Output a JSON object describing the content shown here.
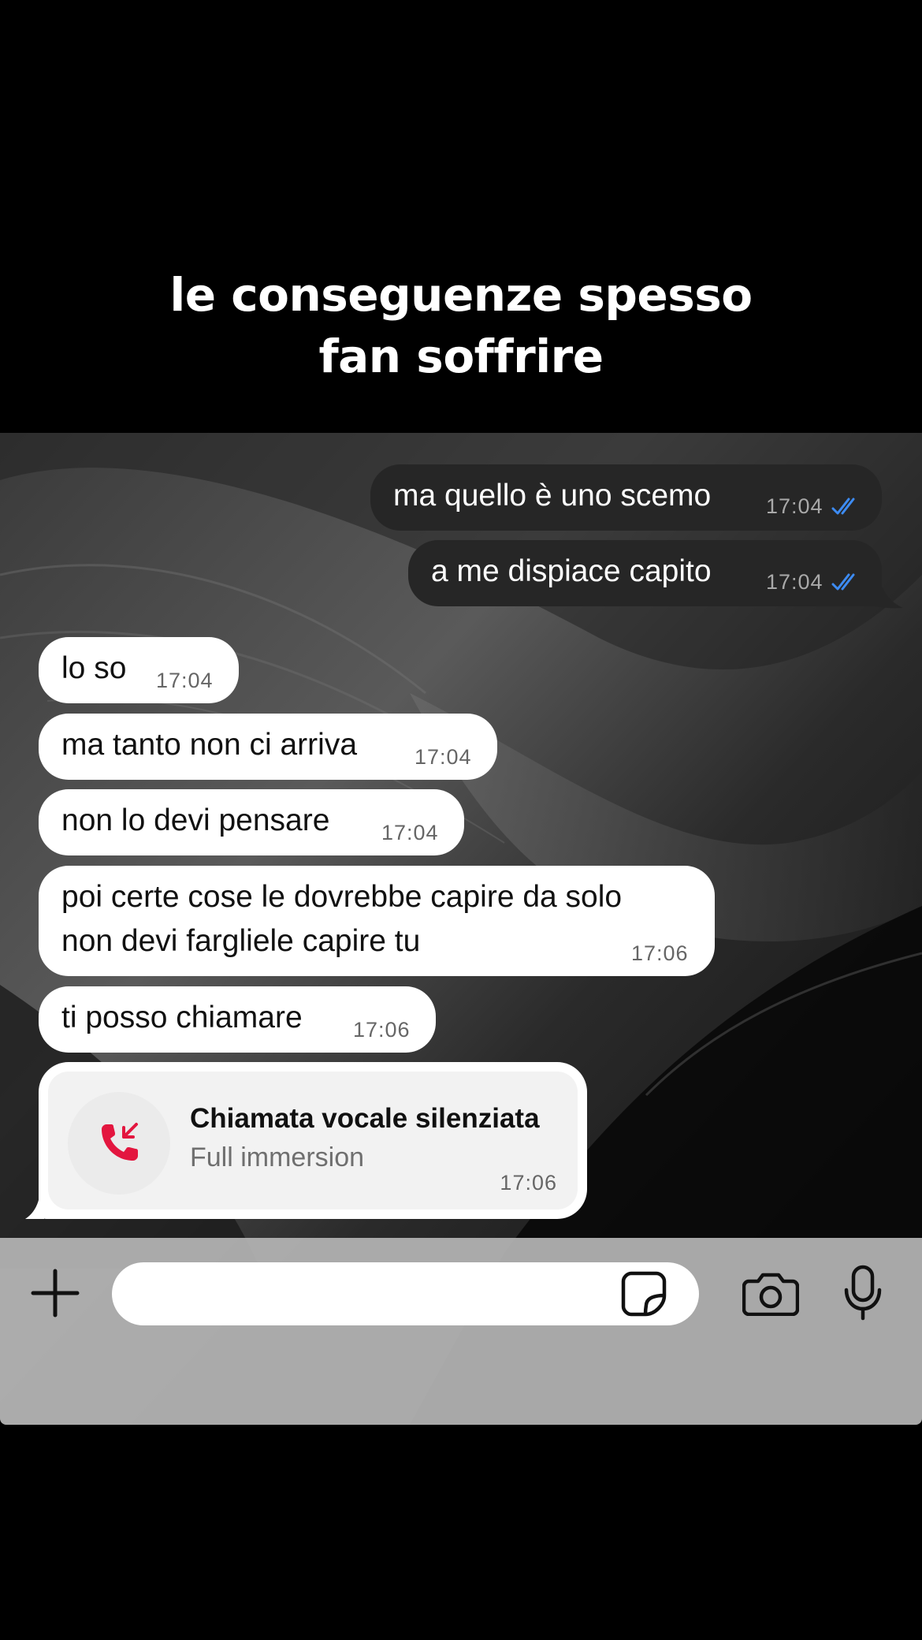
{
  "caption": {
    "line1": "le conseguenze spesso",
    "line2": "fan soffrire"
  },
  "messages": [
    {
      "direction": "out",
      "text": "ma quello è uno scemo",
      "time": "17:04",
      "status": "read"
    },
    {
      "direction": "out",
      "text": "a me dispiace capito",
      "time": "17:04",
      "status": "read"
    },
    {
      "direction": "in",
      "text": "lo so",
      "time": "17:04"
    },
    {
      "direction": "in",
      "text": "ma tanto non ci arriva",
      "time": "17:04"
    },
    {
      "direction": "in",
      "text": "non lo devi pensare",
      "time": "17:04"
    },
    {
      "direction": "in",
      "lines": [
        "poi certe cose le dovrebbe capire da solo",
        "non devi fargliele capire tu"
      ],
      "time": "17:06"
    },
    {
      "direction": "in",
      "text": "ti posso chiamare",
      "time": "17:06"
    }
  ],
  "call": {
    "title": "Chiamata vocale silenziata",
    "subtitle": "Full immersion",
    "time": "17:06",
    "icon": "missed-call-icon"
  },
  "composer": {
    "attach_icon": "plus-icon",
    "sticker_icon": "sticker-icon",
    "camera_icon": "camera-icon",
    "mic_icon": "microphone-icon",
    "input_value": ""
  },
  "colors": {
    "read_ticks": "#3d8bf2",
    "call_icon": "#e3163f",
    "outgoing_bubble": "#262626",
    "incoming_bubble": "#ffffff"
  }
}
